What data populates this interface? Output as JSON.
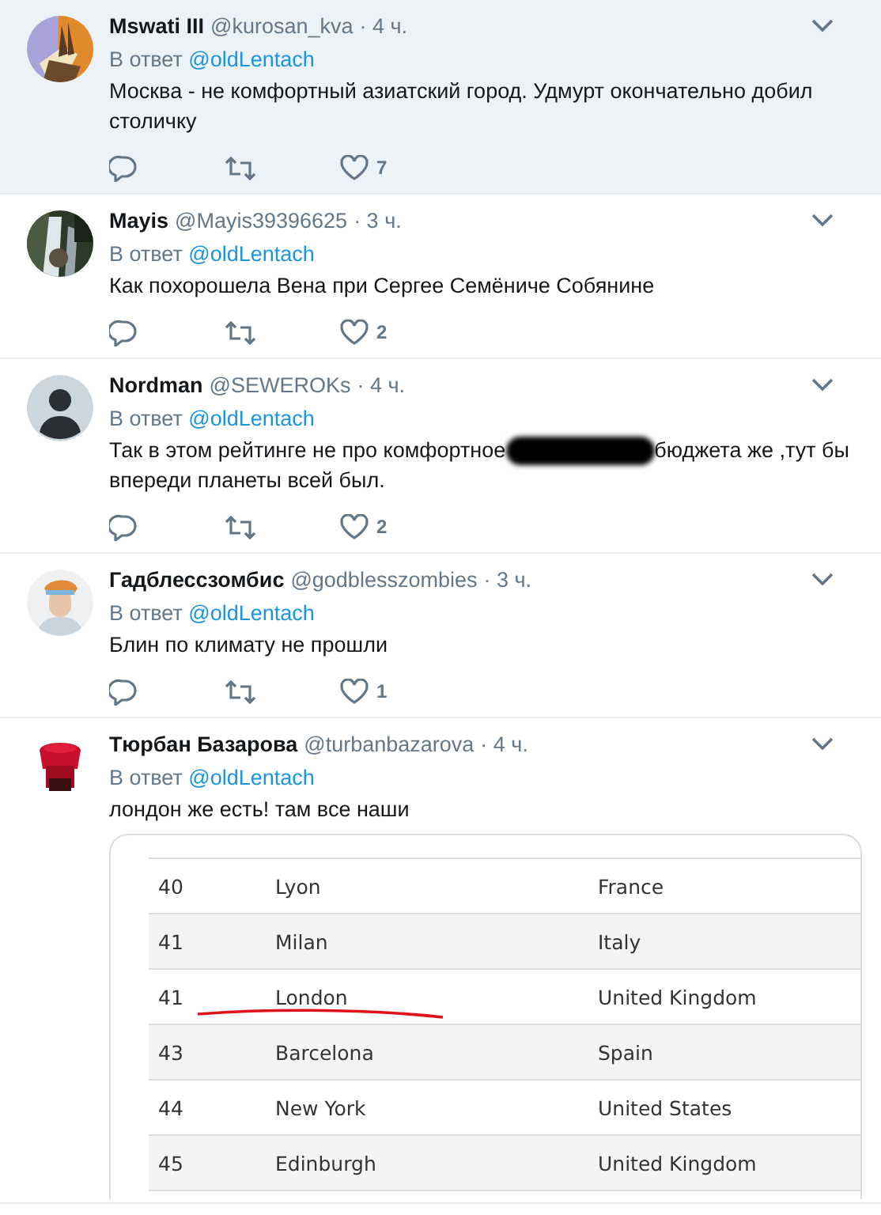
{
  "tweets": [
    {
      "name": "Mswati III",
      "handle": "@kurosan_kva",
      "time": "· 4 ч.",
      "highlighted": true,
      "reply_label": "В ответ",
      "reply_to": "@oldLentach",
      "body": [
        {
          "kind": "text",
          "text": "Москва - не комфортный азиатский город. Удмурт окончательно добил столичку"
        }
      ],
      "likes": "7"
    },
    {
      "name": "Mayis",
      "handle": "@Mayis39396625",
      "time": "· 3 ч.",
      "highlighted": false,
      "reply_label": "В ответ",
      "reply_to": "@oldLentach",
      "body": [
        {
          "kind": "text",
          "text": "Как похорошела Вена при Сергее Семёниче Собянине"
        }
      ],
      "likes": "2"
    },
    {
      "name": "Nordman",
      "handle": "@SEWEROKs",
      "time": "· 4 ч.",
      "highlighted": false,
      "avatar": {
        "kind": "default"
      },
      "reply_label": "В ответ",
      "reply_to": "@oldLentach",
      "body": [
        {
          "kind": "text",
          "text": "Так в этом  рейтинге не про комфортное"
        },
        {
          "kind": "redacted"
        },
        {
          "kind": "text",
          "text": "бюджета же ,тут бы впереди планеты всей был."
        }
      ],
      "likes": "2"
    },
    {
      "name": "Гадблессзомбис",
      "handle": "@godblesszombies",
      "time": "· 3 ч.",
      "highlighted": false,
      "reply_label": "В ответ",
      "reply_to": "@oldLentach",
      "body": [
        {
          "kind": "text",
          "text": "Блин по климату не прошли"
        }
      ],
      "likes": "1"
    },
    {
      "name": "Тюрбан Базарова",
      "handle": "@turbanbazarova",
      "time": "· 4 ч.",
      "highlighted": false,
      "reply_label": "В ответ",
      "reply_to": "@oldLentach",
      "body": [
        {
          "kind": "text",
          "text": "лондон же есть! там все наши"
        }
      ],
      "attached_table": {
        "rows": [
          {
            "rank": "40",
            "city": "Lyon",
            "country": "France",
            "underlined": false
          },
          {
            "rank": "41",
            "city": "Milan",
            "country": "Italy",
            "underlined": false
          },
          {
            "rank": "41",
            "city": "London",
            "country": "United Kingdom",
            "underlined": true
          },
          {
            "rank": "43",
            "city": "Barcelona",
            "country": "Spain",
            "underlined": false
          },
          {
            "rank": "44",
            "city": "New York",
            "country": "United States",
            "underlined": false
          },
          {
            "rank": "45",
            "city": "Edinburgh",
            "country": "United Kingdom",
            "underlined": false
          }
        ]
      }
    }
  ]
}
